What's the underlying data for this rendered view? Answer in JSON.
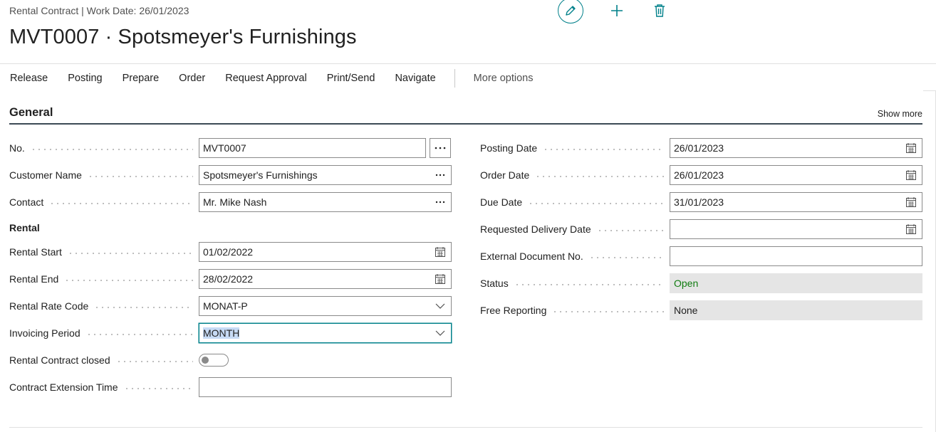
{
  "header": {
    "breadcrumb": "Rental Contract | Work Date: 26/01/2023",
    "title": "MVT0007 · Spotsmeyer's Furnishings",
    "icons": {
      "edit": "pencil-icon",
      "new": "plus-icon",
      "delete": "trash-icon"
    }
  },
  "actions": [
    "Release",
    "Posting",
    "Prepare",
    "Order",
    "Request Approval",
    "Print/Send",
    "Navigate"
  ],
  "more_options": "More options",
  "section": {
    "title": "General",
    "show_more": "Show more"
  },
  "left_fields": {
    "no": {
      "label": "No.",
      "value": "MVT0007"
    },
    "customer_name": {
      "label": "Customer Name",
      "value": "Spotsmeyer's Furnishings"
    },
    "contact": {
      "label": "Contact",
      "value": "Mr. Mike Nash"
    },
    "group_rental": "Rental",
    "rental_start": {
      "label": "Rental Start",
      "value": "01/02/2022"
    },
    "rental_end": {
      "label": "Rental End",
      "value": "28/02/2022"
    },
    "rental_rate_code": {
      "label": "Rental Rate Code",
      "value": "MONAT-P"
    },
    "invoicing_period": {
      "label": "Invoicing Period",
      "value": "MONTH"
    },
    "contract_closed": {
      "label": "Rental Contract closed",
      "value": false
    },
    "extension_time": {
      "label": "Contract Extension Time",
      "value": ""
    }
  },
  "right_fields": {
    "posting_date": {
      "label": "Posting Date",
      "value": "26/01/2023"
    },
    "order_date": {
      "label": "Order Date",
      "value": "26/01/2023"
    },
    "due_date": {
      "label": "Due Date",
      "value": "31/01/2023"
    },
    "requested_delivery": {
      "label": "Requested Delivery Date",
      "value": ""
    },
    "external_doc": {
      "label": "External Document No.",
      "value": ""
    },
    "status": {
      "label": "Status",
      "value": "Open"
    },
    "free_reporting": {
      "label": "Free Reporting",
      "value": "None"
    }
  },
  "colors": {
    "accent": "#00808a",
    "status_open": "#107c10",
    "section_rule": "#3c4a55"
  }
}
